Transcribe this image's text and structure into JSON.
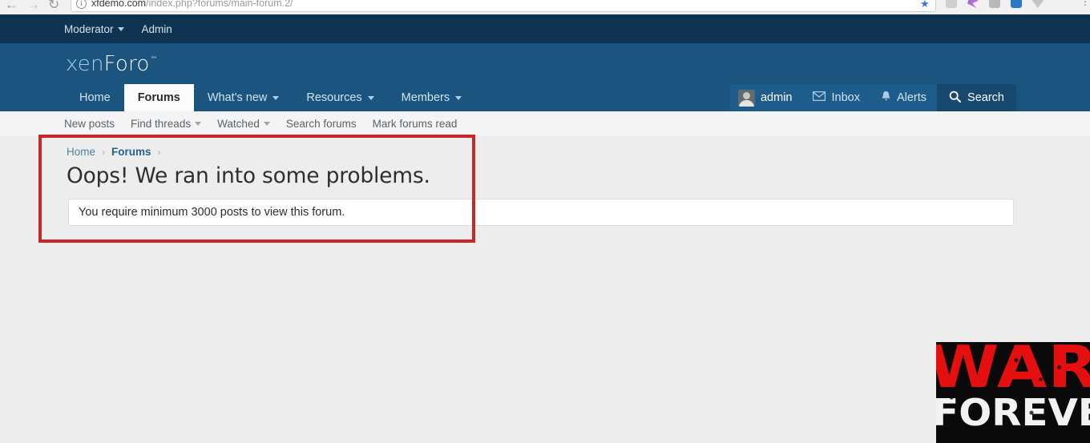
{
  "browser": {
    "back_icon": "back-arrow-icon",
    "forward_icon": "forward-arrow-icon",
    "reload_icon": "reload-icon",
    "site_info_icon": "info-circle-icon",
    "url_host": "xfdemo.com",
    "url_path": "/index.php?forums/main-forum.2/",
    "bookmark_icon": "star-icon",
    "menu_icon": "kebab-menu-icon"
  },
  "admin_bar": {
    "items": [
      {
        "label": "Moderator",
        "has_caret": true
      },
      {
        "label": "Admin",
        "has_caret": false
      }
    ]
  },
  "header": {
    "logo_part1": "xen",
    "logo_part2": "Foro",
    "logo_tm": "™",
    "nav_tabs": [
      {
        "label": "Home",
        "active": false,
        "has_caret": false
      },
      {
        "label": "Forums",
        "active": true,
        "has_caret": false
      },
      {
        "label": "What's new",
        "active": false,
        "has_caret": true
      },
      {
        "label": "Resources",
        "active": false,
        "has_caret": true
      },
      {
        "label": "Members",
        "active": false,
        "has_caret": true
      }
    ],
    "visitor": {
      "username": "admin",
      "inbox_label": "Inbox",
      "alerts_label": "Alerts",
      "search_label": "Search"
    }
  },
  "sub_nav": {
    "items": [
      {
        "label": "New posts",
        "has_caret": false
      },
      {
        "label": "Find threads",
        "has_caret": true
      },
      {
        "label": "Watched",
        "has_caret": true
      },
      {
        "label": "Search forums",
        "has_caret": false
      },
      {
        "label": "Mark forums read",
        "has_caret": false
      }
    ]
  },
  "content": {
    "breadcrumb": [
      {
        "label": "Home",
        "strong": false
      },
      {
        "label": "Forums",
        "strong": true
      }
    ],
    "breadcrumb_separator": "›",
    "page_title": "Oops! We ran into some problems.",
    "error_message": "You require minimum 3000 posts to view this forum."
  },
  "annotation": {
    "color": "#c62828"
  },
  "watermark": {
    "line1": "WAR",
    "line2": "FOREVER",
    "color1": "#e60f0f",
    "color2": "#f2f2f2",
    "background": "#0a0a0a"
  }
}
